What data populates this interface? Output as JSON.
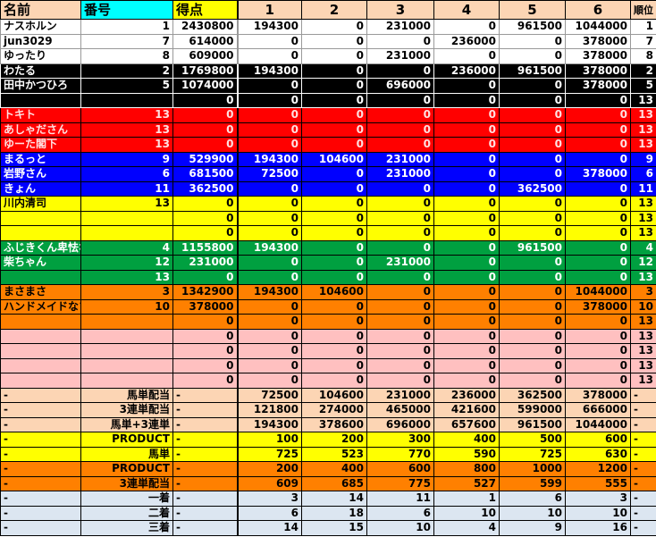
{
  "header": {
    "name": "名前",
    "number": "番号",
    "score": "得点",
    "races": [
      "1",
      "2",
      "3",
      "4",
      "5",
      "6"
    ],
    "rank": "順位"
  },
  "header_colors": {
    "default": "#fcd5b4",
    "number": "#00ffff",
    "score": "#ffff00"
  },
  "rows": [
    {
      "g": "white",
      "cells": [
        "ナスホルン",
        "1",
        "2430800",
        "194300",
        "0",
        "231000",
        "0",
        "961500",
        "1044000",
        "1"
      ]
    },
    {
      "g": "white",
      "cells": [
        "jun3029",
        "7",
        "614000",
        "0",
        "0",
        "0",
        "236000",
        "0",
        "378000",
        "7"
      ]
    },
    {
      "g": "white",
      "cells": [
        "ゆったり",
        "8",
        "609000",
        "0",
        "0",
        "231000",
        "0",
        "0",
        "378000",
        "8"
      ]
    },
    {
      "g": "black",
      "cells": [
        "わたる",
        "2",
        "1769800",
        "194300",
        "0",
        "0",
        "236000",
        "961500",
        "378000",
        "2"
      ]
    },
    {
      "g": "black",
      "cells": [
        "田中かつひろ",
        "5",
        "1074000",
        "0",
        "0",
        "696000",
        "0",
        "0",
        "378000",
        "5"
      ]
    },
    {
      "g": "black",
      "cells": [
        "",
        "",
        "0",
        "0",
        "0",
        "0",
        "0",
        "0",
        "0",
        "13"
      ]
    },
    {
      "g": "red",
      "cells": [
        "トキト",
        "13",
        "0",
        "0",
        "0",
        "0",
        "0",
        "0",
        "0",
        "13"
      ]
    },
    {
      "g": "red",
      "cells": [
        "あしゃださん",
        "13",
        "0",
        "0",
        "0",
        "0",
        "0",
        "0",
        "0",
        "13"
      ]
    },
    {
      "g": "red",
      "cells": [
        "ゆーた閣下",
        "13",
        "0",
        "0",
        "0",
        "0",
        "0",
        "0",
        "0",
        "13"
      ]
    },
    {
      "g": "blue",
      "cells": [
        "まるっと",
        "9",
        "529900",
        "194300",
        "104600",
        "231000",
        "0",
        "0",
        "0",
        "9"
      ]
    },
    {
      "g": "blue",
      "cells": [
        "岩野さん",
        "6",
        "681500",
        "72500",
        "0",
        "231000",
        "0",
        "0",
        "378000",
        "6"
      ]
    },
    {
      "g": "blue",
      "cells": [
        "きょん",
        "11",
        "362500",
        "0",
        "0",
        "0",
        "0",
        "362500",
        "0",
        "11"
      ]
    },
    {
      "g": "yellow",
      "cells": [
        "川内清司",
        "13",
        "0",
        "0",
        "0",
        "0",
        "0",
        "0",
        "0",
        "13"
      ]
    },
    {
      "g": "yellow",
      "cells": [
        "",
        "",
        "0",
        "0",
        "0",
        "0",
        "0",
        "0",
        "0",
        "13"
      ]
    },
    {
      "g": "yellow",
      "cells": [
        "",
        "",
        "0",
        "0",
        "0",
        "0",
        "0",
        "0",
        "0",
        "13"
      ]
    },
    {
      "g": "green",
      "cells": [
        "ふじきくん卑怯な",
        "4",
        "1155800",
        "194300",
        "0",
        "0",
        "0",
        "961500",
        "0",
        "4"
      ]
    },
    {
      "g": "green",
      "cells": [
        "柴ちゃん",
        "12",
        "231000",
        "0",
        "0",
        "231000",
        "0",
        "0",
        "0",
        "12"
      ]
    },
    {
      "g": "green",
      "cells": [
        "",
        "13",
        "0",
        "0",
        "0",
        "0",
        "0",
        "0",
        "0",
        "13"
      ]
    },
    {
      "g": "orange",
      "cells": [
        "まさまさ",
        "3",
        "1342900",
        "194300",
        "104600",
        "0",
        "0",
        "0",
        "1044000",
        "3"
      ]
    },
    {
      "g": "orange",
      "cells": [
        "ハンドメイドなソフ",
        "10",
        "378000",
        "0",
        "0",
        "0",
        "0",
        "0",
        "378000",
        "10"
      ]
    },
    {
      "g": "orange",
      "cells": [
        "",
        "",
        "0",
        "0",
        "0",
        "0",
        "0",
        "0",
        "0",
        "13"
      ]
    },
    {
      "g": "pink",
      "cells": [
        "",
        "",
        "0",
        "0",
        "0",
        "0",
        "0",
        "0",
        "0",
        "13"
      ]
    },
    {
      "g": "pink",
      "cells": [
        "",
        "",
        "0",
        "0",
        "0",
        "0",
        "0",
        "0",
        "0",
        "13"
      ]
    },
    {
      "g": "pink",
      "cells": [
        "",
        "",
        "0",
        "0",
        "0",
        "0",
        "0",
        "0",
        "0",
        "13"
      ]
    },
    {
      "g": "pink",
      "cells": [
        "",
        "",
        "0",
        "0",
        "0",
        "0",
        "0",
        "0",
        "0",
        "13"
      ]
    },
    {
      "g": "peach",
      "s": 1,
      "cells": [
        "-",
        "馬単配当",
        "-",
        "72500",
        "104600",
        "231000",
        "236000",
        "362500",
        "378000",
        "-"
      ]
    },
    {
      "g": "peach",
      "s": 1,
      "cells": [
        "-",
        "3連単配当",
        "-",
        "121800",
        "274000",
        "465000",
        "421600",
        "599000",
        "666000",
        "-"
      ]
    },
    {
      "g": "peach",
      "s": 1,
      "cells": [
        "-",
        "馬単+3連単",
        "-",
        "194300",
        "378600",
        "696000",
        "657600",
        "961500",
        "1044000",
        "-"
      ]
    },
    {
      "g": "yellow",
      "s": 1,
      "cells": [
        "-",
        "PRODUCT",
        "-",
        "100",
        "200",
        "300",
        "400",
        "500",
        "600",
        "-"
      ]
    },
    {
      "g": "yellow",
      "s": 1,
      "cells": [
        "-",
        "馬単",
        "-",
        "725",
        "523",
        "770",
        "590",
        "725",
        "630",
        "-"
      ]
    },
    {
      "g": "orange",
      "s": 1,
      "cells": [
        "-",
        "PRODUCT",
        "-",
        "200",
        "400",
        "600",
        "800",
        "1000",
        "1200",
        "-"
      ]
    },
    {
      "g": "orange",
      "s": 1,
      "cells": [
        "-",
        "3連単配当",
        "-",
        "609",
        "685",
        "775",
        "527",
        "599",
        "555",
        "-"
      ]
    },
    {
      "g": "gray",
      "s": 1,
      "cells": [
        "-",
        "一着",
        "-",
        "3",
        "14",
        "11",
        "1",
        "6",
        "3",
        "-"
      ]
    },
    {
      "g": "gray",
      "s": 1,
      "cells": [
        "-",
        "二着",
        "-",
        "6",
        "18",
        "6",
        "10",
        "10",
        "10",
        "-"
      ]
    },
    {
      "g": "gray",
      "s": 1,
      "cells": [
        "-",
        "三着",
        "-",
        "14",
        "15",
        "10",
        "4",
        "9",
        "16",
        "-"
      ]
    }
  ]
}
